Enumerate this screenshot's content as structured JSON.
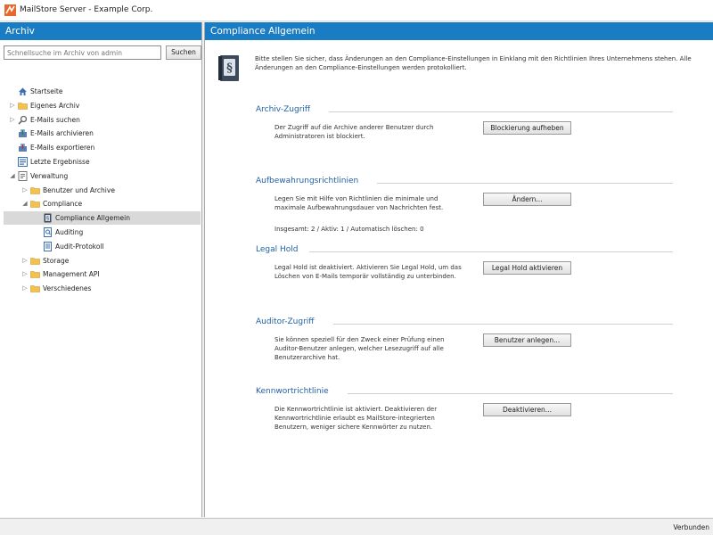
{
  "window": {
    "title": "MailStore Server - Example Corp."
  },
  "left": {
    "header": "Archiv",
    "search": {
      "placeholder": "Schnellsuche im Archiv von admin",
      "button": "Suchen"
    },
    "tree": [
      {
        "label": "Startseite",
        "icon": "home-icon",
        "level": 0,
        "expander": ""
      },
      {
        "label": "Eigenes Archiv",
        "icon": "folder-icon",
        "level": 0,
        "expander": "▷"
      },
      {
        "label": "E-Mails suchen",
        "icon": "search-icon",
        "level": 0,
        "expander": "▷"
      },
      {
        "label": "E-Mails archivieren",
        "icon": "archive-icon",
        "level": 0,
        "expander": ""
      },
      {
        "label": "E-Mails exportieren",
        "icon": "export-icon",
        "level": 0,
        "expander": ""
      },
      {
        "label": "Letzte Ergebnisse",
        "icon": "results-icon",
        "level": 0,
        "expander": ""
      },
      {
        "label": "Verwaltung",
        "icon": "management-icon",
        "level": 0,
        "expander": "◢"
      },
      {
        "label": "Benutzer und Archive",
        "icon": "folder-icon",
        "level": 1,
        "expander": "▷"
      },
      {
        "label": "Compliance",
        "icon": "folder-icon",
        "level": 1,
        "expander": "◢"
      },
      {
        "label": "Compliance Allgemein",
        "icon": "law-book-icon",
        "level": 2,
        "expander": "",
        "selected": true
      },
      {
        "label": "Auditing",
        "icon": "audit-icon",
        "level": 2,
        "expander": ""
      },
      {
        "label": "Audit-Protokoll",
        "icon": "audit-log-icon",
        "level": 2,
        "expander": ""
      },
      {
        "label": "Storage",
        "icon": "folder-icon",
        "level": 1,
        "expander": "▷"
      },
      {
        "label": "Management API",
        "icon": "folder-icon",
        "level": 1,
        "expander": "▷"
      },
      {
        "label": "Verschiedenes",
        "icon": "folder-icon",
        "level": 1,
        "expander": "▷"
      }
    ]
  },
  "right": {
    "header": "Compliance Allgemein",
    "intro": "Bitte stellen Sie sicher, dass Änderungen an den Compliance-Einstellungen in Einklang mit den Richtlinien Ihres Unternehmens stehen. Alle Änderungen an den Compliance-Einstellungen werden protokolliert.",
    "sections": [
      {
        "title": "Archiv-Zugriff",
        "text": "Der Zugriff auf die Archive anderer Benutzer durch Administratoren ist blockiert.",
        "extra": "",
        "button": "Blockierung aufheben"
      },
      {
        "title": "Aufbewahrungsrichtlinien",
        "text": "Legen Sie mit Hilfe von Richtlinien die minimale und maximale Aufbewahrungsdauer von Nachrichten fest.",
        "extra": "Insgesamt: 2 / Aktiv: 1 / Automatisch löschen: 0",
        "button": "Ändern..."
      },
      {
        "title": "Legal Hold",
        "text": "Legal Hold ist deaktiviert. Aktivieren Sie Legal Hold, um das Löschen von E-Mails temporär vollständig zu unterbinden.",
        "extra": "",
        "button": "Legal Hold aktivieren"
      },
      {
        "title": "Auditor-Zugriff",
        "text": "Sie können speziell für den Zweck einer Prüfung einen Auditor-Benutzer anlegen, welcher Lesezugriff auf alle Benutzerarchive hat.",
        "extra": "",
        "button": "Benutzer anlegen..."
      },
      {
        "title": "Kennwortrichtlinie",
        "text": "Die Kennwortrichtlinie ist aktiviert. Deaktivieren der Kennwortrichtlinie erlaubt es MailStore-integrierten Benutzern, weniger sichere Kennwörter zu nutzen.",
        "extra": "",
        "button": "Deaktivieren..."
      }
    ]
  },
  "status": {
    "text": "Verbunden"
  },
  "colors": {
    "header": "#1a7dc4",
    "section_title": "#1f5fa5",
    "selected": "#d9d9d9"
  }
}
